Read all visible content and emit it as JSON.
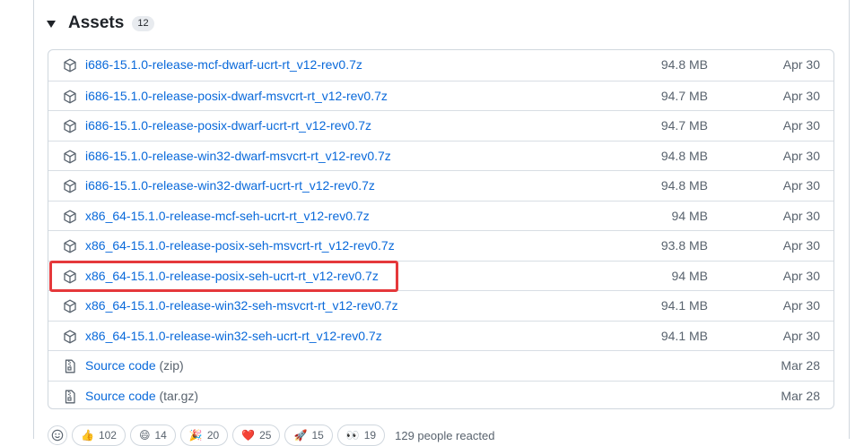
{
  "assets": {
    "title": "Assets",
    "count": "12",
    "files": [
      {
        "name": "i686-15.1.0-release-mcf-dwarf-ucrt-rt_v12-rev0.7z",
        "size": "94.8 MB",
        "date": "Apr 30",
        "icon": "package-icon"
      },
      {
        "name": "i686-15.1.0-release-posix-dwarf-msvcrt-rt_v12-rev0.7z",
        "size": "94.7 MB",
        "date": "Apr 30",
        "icon": "package-icon"
      },
      {
        "name": "i686-15.1.0-release-posix-dwarf-ucrt-rt_v12-rev0.7z",
        "size": "94.7 MB",
        "date": "Apr 30",
        "icon": "package-icon"
      },
      {
        "name": "i686-15.1.0-release-win32-dwarf-msvcrt-rt_v12-rev0.7z",
        "size": "94.8 MB",
        "date": "Apr 30",
        "icon": "package-icon"
      },
      {
        "name": "i686-15.1.0-release-win32-dwarf-ucrt-rt_v12-rev0.7z",
        "size": "94.8 MB",
        "date": "Apr 30",
        "icon": "package-icon"
      },
      {
        "name": "x86_64-15.1.0-release-mcf-seh-ucrt-rt_v12-rev0.7z",
        "size": "94 MB",
        "date": "Apr 30",
        "icon": "package-icon"
      },
      {
        "name": "x86_64-15.1.0-release-posix-seh-msvcrt-rt_v12-rev0.7z",
        "size": "93.8 MB",
        "date": "Apr 30",
        "icon": "package-icon"
      },
      {
        "name": "x86_64-15.1.0-release-posix-seh-ucrt-rt_v12-rev0.7z",
        "size": "94 MB",
        "date": "Apr 30",
        "icon": "package-icon"
      },
      {
        "name": "x86_64-15.1.0-release-win32-seh-msvcrt-rt_v12-rev0.7z",
        "size": "94.1 MB",
        "date": "Apr 30",
        "icon": "package-icon"
      },
      {
        "name": "x86_64-15.1.0-release-win32-seh-ucrt-rt_v12-rev0.7z",
        "size": "94.1 MB",
        "date": "Apr 30",
        "icon": "package-icon"
      }
    ],
    "source": [
      {
        "label": "Source code",
        "ext": "(zip)",
        "date": "Mar 28",
        "icon": "file-zip-icon"
      },
      {
        "label": "Source code",
        "ext": "(tar.gz)",
        "date": "Mar 28",
        "icon": "file-zip-icon"
      }
    ]
  },
  "reactions": {
    "items": [
      {
        "emoji": "👍",
        "count": "102",
        "icon": "thumbs-up-icon"
      },
      {
        "emoji": "😄",
        "count": "14",
        "icon": "laugh-icon"
      },
      {
        "emoji": "🎉",
        "count": "20",
        "icon": "hooray-icon"
      },
      {
        "emoji": "❤️",
        "count": "25",
        "icon": "heart-icon"
      },
      {
        "emoji": "🚀",
        "count": "15",
        "icon": "rocket-icon"
      },
      {
        "emoji": "👀",
        "count": "19",
        "icon": "eyes-icon"
      }
    ],
    "summary": "129 people reacted"
  },
  "colors": {
    "link": "#0969da",
    "highlight": "#e5383b",
    "muted": "#59636e"
  }
}
